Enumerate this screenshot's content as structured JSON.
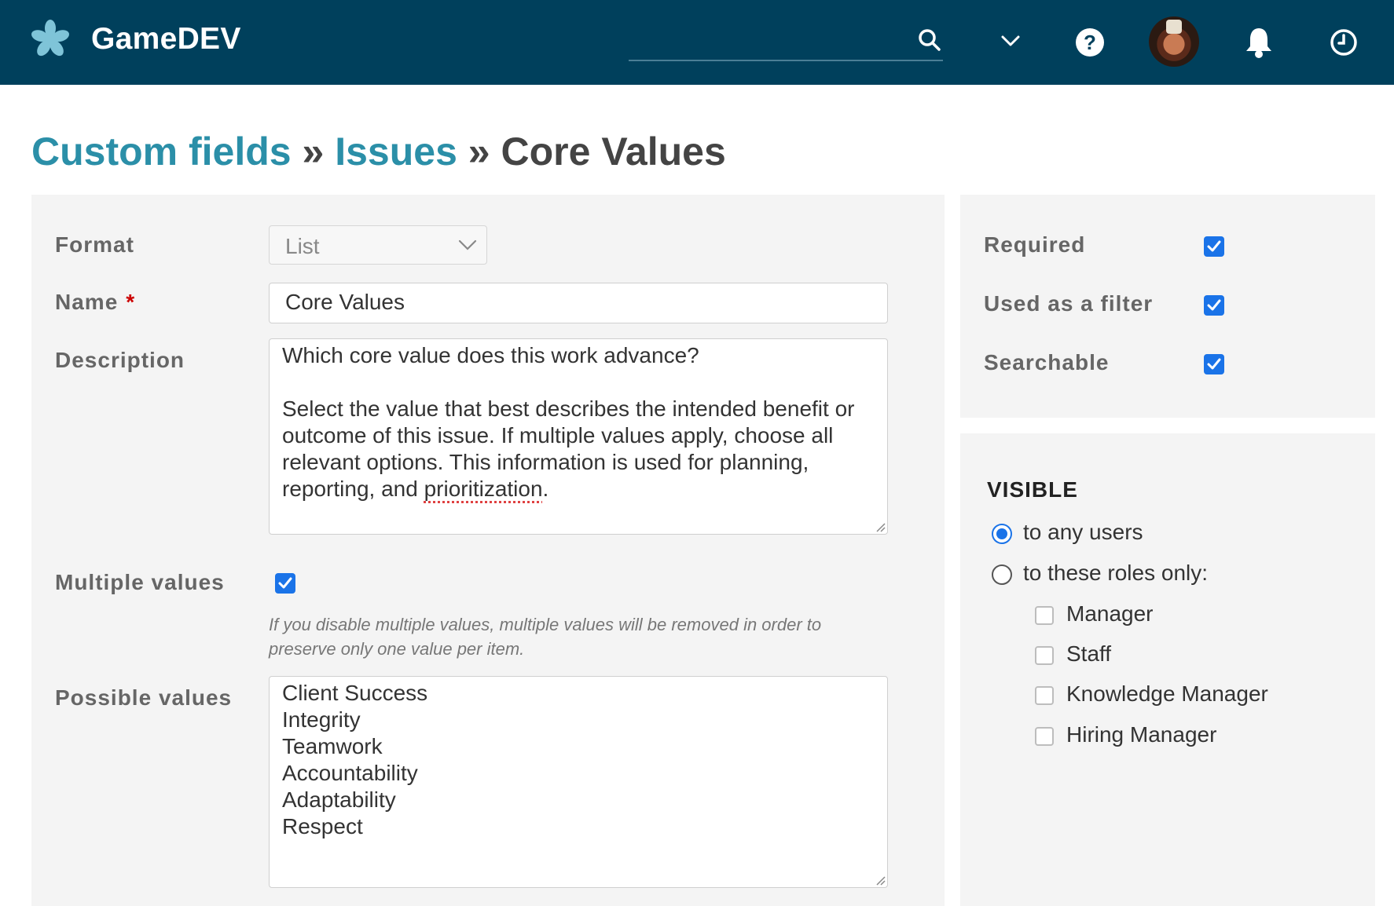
{
  "header": {
    "app_title": "GameDEV",
    "logo_icon": "asterisk-logo-icon",
    "search_value": "",
    "icons": [
      "search-icon",
      "chevron-down-icon",
      "help-icon",
      "avatar",
      "bell-icon",
      "clock-icon"
    ],
    "colors": {
      "bar": "#00405c",
      "accent": "#1a73e8",
      "link": "#2b8fa8"
    }
  },
  "breadcrumb": {
    "link1": "Custom fields",
    "sep": "»",
    "link2": "Issues",
    "current": "Core Values"
  },
  "form": {
    "format_label": "Format",
    "format_value": "List",
    "name_label": "Name",
    "name_required_mark": "*",
    "name_value": "Core Values",
    "description_label": "Description",
    "description_line1": "Which core value does this work advance?",
    "description_line2": "Select the value that best describes the intended benefit or outcome of this issue. If multiple values apply, choose all relevant options. This information is used for planning, reporting, and ",
    "description_misspelled": "prioritization",
    "description_end": ".",
    "multiple_label": "Multiple values",
    "multiple_checked": true,
    "multiple_hint": "If you disable multiple values, multiple values will be removed in order to preserve only one value per item.",
    "possible_label": "Possible values",
    "possible_values": [
      "Client Success",
      "Integrity",
      "Teamwork",
      "Accountability",
      "Adaptability",
      "Respect"
    ]
  },
  "flags": {
    "required_label": "Required",
    "required_checked": true,
    "filter_label": "Used as a filter",
    "filter_checked": true,
    "searchable_label": "Searchable",
    "searchable_checked": true
  },
  "visibility": {
    "heading": "VISIBLE",
    "any_users": "to any users",
    "roles_only": "to these roles only:",
    "selected": "to any users",
    "roles": [
      "Manager",
      "Staff",
      "Knowledge Manager",
      "Hiring Manager"
    ]
  }
}
